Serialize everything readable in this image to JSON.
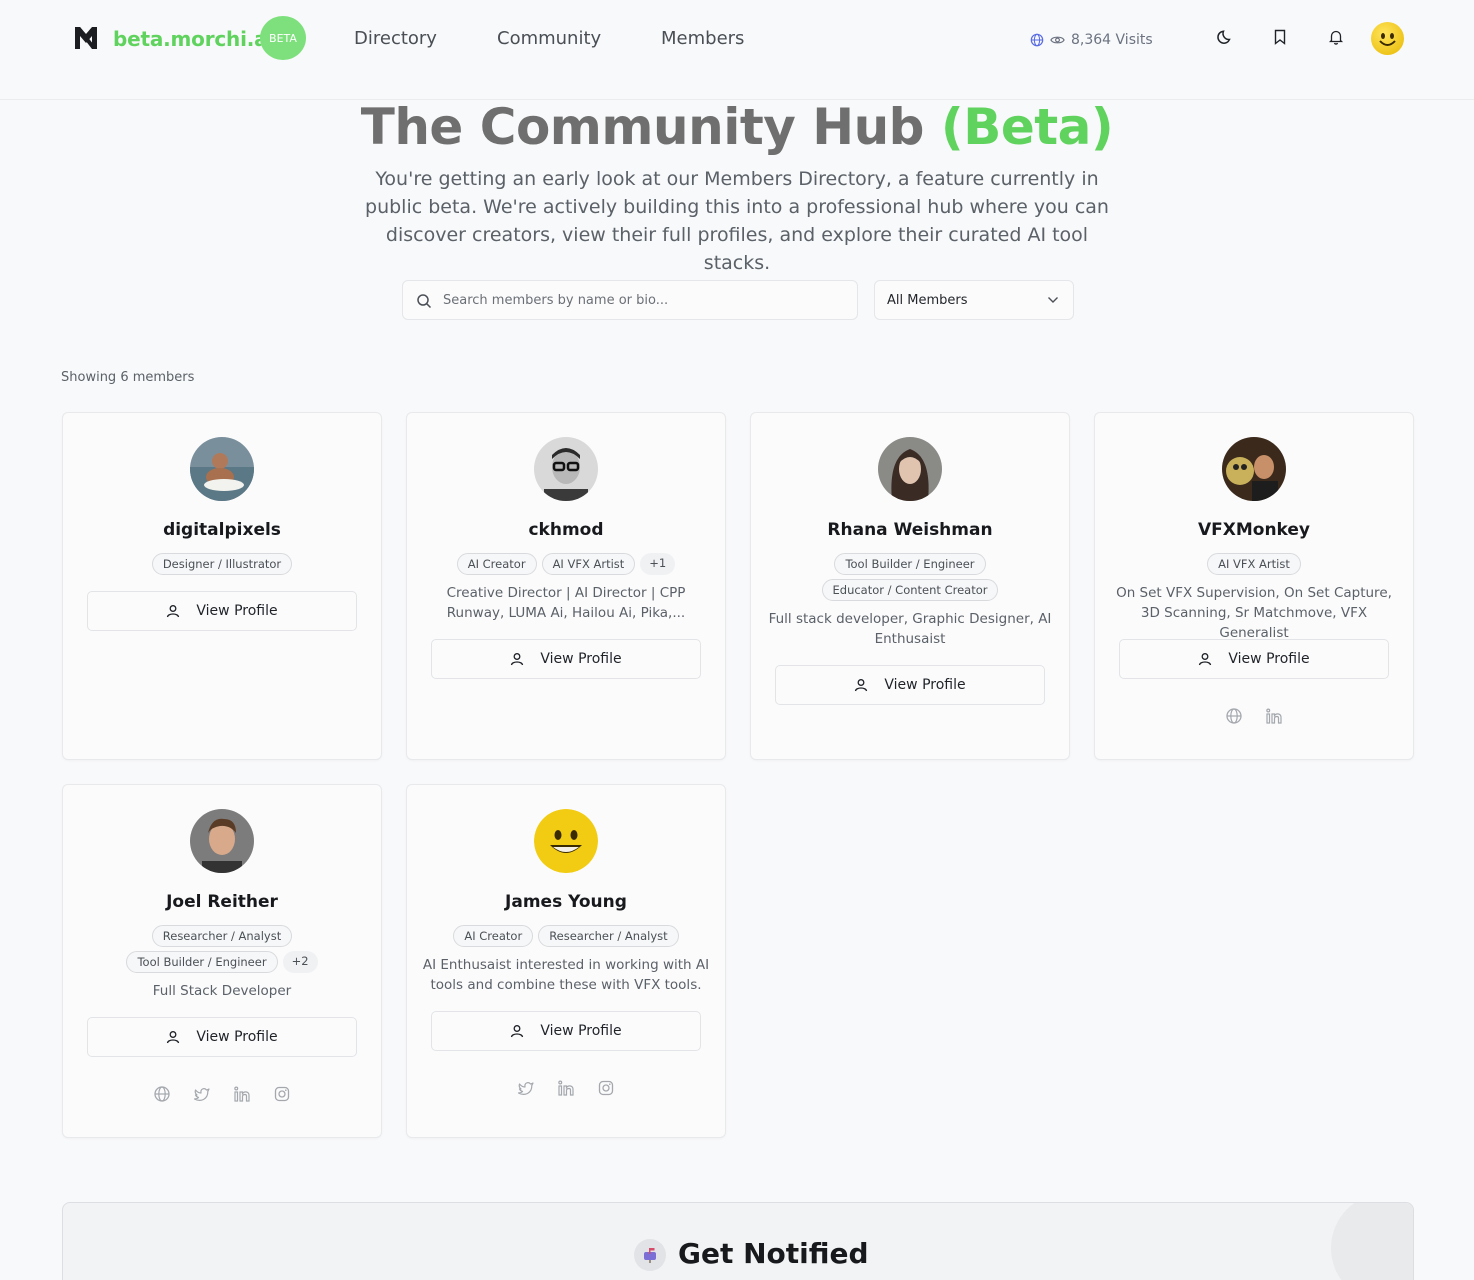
{
  "header": {
    "brand": "beta.morchi.ai",
    "badge": "BETA",
    "nav": [
      "Directory",
      "Community",
      "Members"
    ],
    "visits": "8,364 Visits",
    "icons": [
      "moon-icon",
      "bookmark-icon",
      "bell-icon"
    ]
  },
  "hero": {
    "title": "The Community Hub",
    "title_accent": "(Beta)",
    "subtitle": "You're getting an early look at our Members Directory, a feature currently in public beta. We're actively building this into a professional hub where you can discover creators, view their full profiles, and explore their curated AI tool stacks."
  },
  "search": {
    "placeholder": "Search members by name or bio..."
  },
  "filter": {
    "selected": "All Members"
  },
  "showing": "Showing 6 members",
  "view_profile_label": "View Profile",
  "members": [
    {
      "name": "digitalpixels",
      "tags": [
        "Designer / Illustrator"
      ],
      "more": "",
      "bio": ""
    },
    {
      "name": "ckhmod",
      "tags": [
        "AI Creator",
        "AI VFX Artist"
      ],
      "more": "+1",
      "bio": "Creative Director | AI Director | CPP Runway, LUMA Ai, Hailou Ai, Pika,..."
    },
    {
      "name": "Rhana Weishman",
      "tags": [
        "Tool Builder / Engineer",
        "Educator / Content Creator"
      ],
      "more": "",
      "bio": "Full stack developer, Graphic Designer, AI Enthusaist"
    },
    {
      "name": "VFXMonkey",
      "tags": [
        "AI VFX Artist"
      ],
      "more": "",
      "bio": "On Set VFX Supervision, On Set Capture, 3D Scanning, Sr Matchmove, VFX Generalist",
      "socials": [
        "globe-icon",
        "linkedin-icon"
      ]
    },
    {
      "name": "Joel Reither",
      "tags": [
        "Researcher / Analyst",
        "Tool Builder / Engineer"
      ],
      "more": "+2",
      "bio": "Full Stack Developer",
      "socials": [
        "globe-icon",
        "twitter-icon",
        "linkedin-icon",
        "instagram-icon"
      ]
    },
    {
      "name": "James Young",
      "tags": [
        "AI Creator",
        "Researcher / Analyst"
      ],
      "more": "",
      "bio": "AI Enthusaist interested in working with AI tools and combine these with VFX tools.",
      "socials": [
        "twitter-icon",
        "linkedin-icon",
        "instagram-icon"
      ]
    }
  ],
  "notify": {
    "title": "Get Notified"
  },
  "colors": {
    "accent": "#5fd35d",
    "title_gray": "#6f6f6f"
  }
}
